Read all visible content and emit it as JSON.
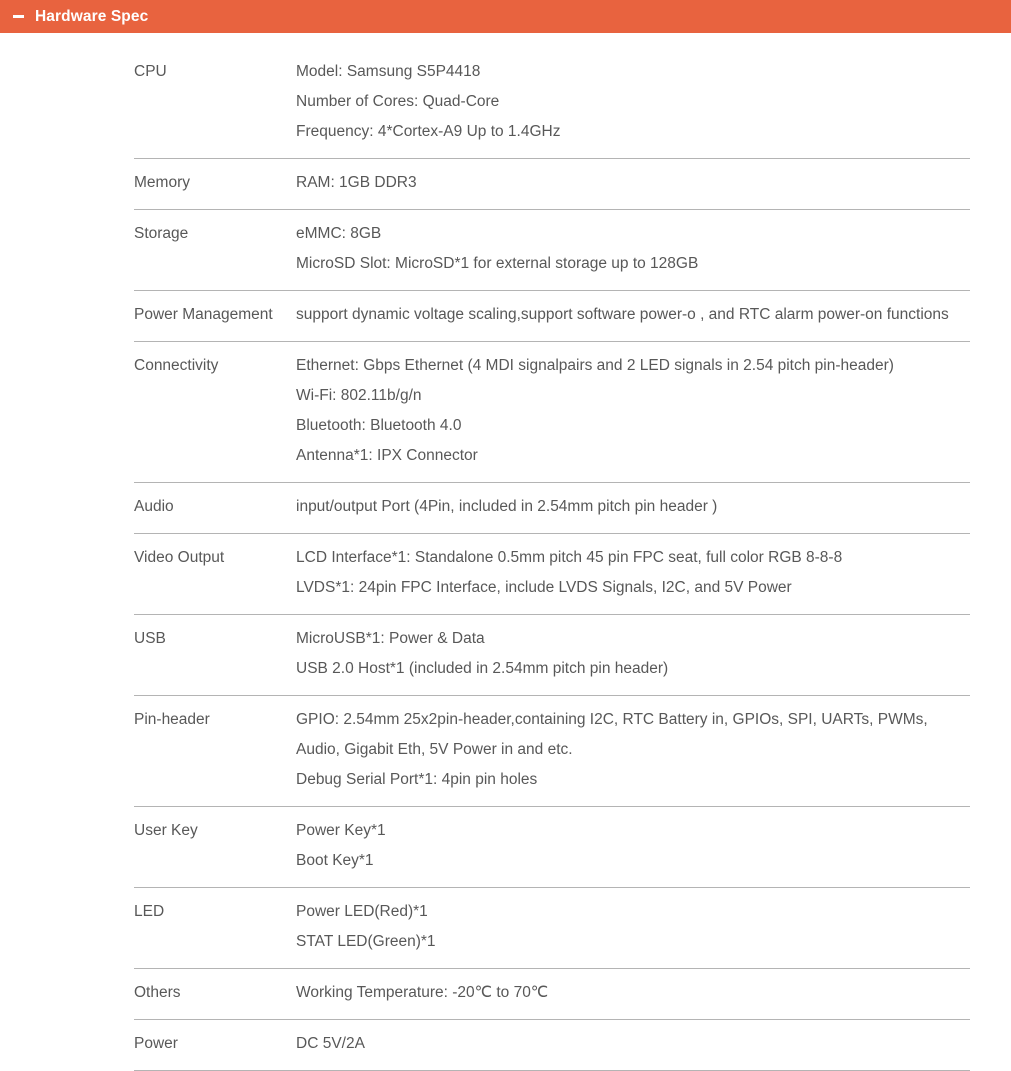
{
  "header": {
    "title": "Hardware Spec",
    "collapse_icon": "minus-icon",
    "accent_color": "#e8633f",
    "title_color": "#ffffff"
  },
  "table": {
    "divider_color": "#b4b4b4",
    "text_color": "#585858",
    "rows": [
      {
        "label": "CPU",
        "lines": [
          "Model: Samsung S5P4418",
          "Number of Cores: Quad-Core",
          "Frequency: 4*Cortex-A9 Up to 1.4GHz"
        ]
      },
      {
        "label": "Memory",
        "lines": [
          "RAM: 1GB DDR3"
        ]
      },
      {
        "label": "Storage",
        "lines": [
          "eMMC: 8GB",
          "MicroSD Slot: MicroSD*1 for external storage up to 128GB"
        ]
      },
      {
        "label": "Power Management",
        "lines": [
          "support dynamic voltage scaling,support software power-o , and RTC alarm power-on functions"
        ]
      },
      {
        "label": "Connectivity",
        "lines": [
          "Ethernet: Gbps Ethernet (4 MDI signalpairs and 2 LED signals in 2.54 pitch pin-header)",
          "Wi-Fi: 802.11b/g/n",
          "Bluetooth: Bluetooth 4.0",
          "Antenna*1: IPX Connector"
        ]
      },
      {
        "label": "Audio",
        "lines": [
          "input/output Port (4Pin, included in 2.54mm pitch pin header )"
        ]
      },
      {
        "label": "Video Output",
        "lines": [
          "LCD Interface*1: Standalone 0.5mm pitch 45 pin FPC seat, full color RGB 8-8-8",
          "LVDS*1: 24pin FPC Interface, include LVDS Signals, I2C, and 5V Power"
        ]
      },
      {
        "label": "USB",
        "lines": [
          "MicroUSB*1: Power & Data",
          "USB 2.0 Host*1 (included in 2.54mm pitch pin header)"
        ]
      },
      {
        "label": "Pin-header",
        "lines": [
          "GPIO: 2.54mm 25x2pin-header,containing I2C, RTC Battery in, GPIOs, SPI, UARTs, PWMs, Audio, Gigabit Eth, 5V Power in and etc.",
          "Debug Serial Port*1: 4pin pin holes"
        ]
      },
      {
        "label": "User Key",
        "lines": [
          "Power Key*1",
          "Boot Key*1"
        ]
      },
      {
        "label": "LED",
        "lines": [
          "Power LED(Red)*1",
          "STAT LED(Green)*1"
        ]
      },
      {
        "label": "Others",
        "lines": [
          "Working Temperature: -20℃ to 70℃"
        ]
      },
      {
        "label": "Power",
        "lines": [
          "DC 5V/2A"
        ]
      }
    ]
  }
}
